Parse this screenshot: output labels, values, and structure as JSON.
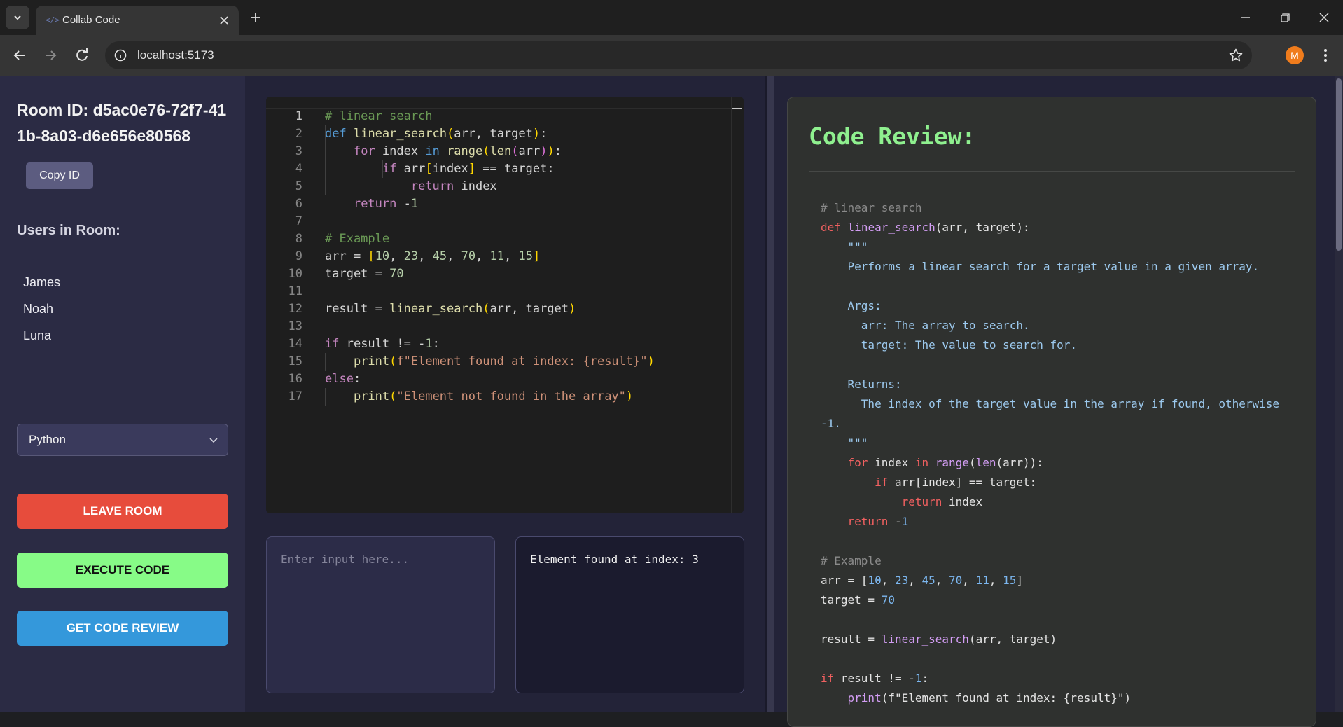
{
  "browser": {
    "tab_title": "Collab Code",
    "url": "localhost:5173",
    "profile_initial": "M"
  },
  "sidebar": {
    "room_id": "Room ID: d5ac0e76-72f7-411b-8a03-d6e656e80568",
    "copy_label": "Copy ID",
    "users_heading": "Users in Room:",
    "users": [
      "James",
      "Noah",
      "Luna"
    ],
    "language": "Python",
    "leave_label": "LEAVE ROOM",
    "execute_label": "EXECUTE CODE",
    "review_label": "GET CODE REVIEW"
  },
  "editor": {
    "current_line": 1,
    "lines": [
      "# linear search",
      "def linear_search(arr, target):",
      "    for index in range(len(arr)):",
      "        if arr[index] == target:",
      "            return index",
      "    return -1",
      "",
      "# Example",
      "arr = [10, 23, 45, 70, 11, 15]",
      "target = 70",
      "",
      "result = linear_search(arr, target)",
      "",
      "if result != -1:",
      "    print(f\"Element found at index: {result}\")",
      "else:",
      "    print(\"Element not found in the array\")"
    ]
  },
  "io": {
    "input_placeholder": "Enter input here...",
    "output": "Element found at index: 3"
  },
  "review": {
    "title": "Code Review:",
    "lines": [
      "# linear search",
      "def linear_search(arr, target):",
      "    \"\"\"",
      "    Performs a linear search for a target value in a given array.",
      "",
      "    Args:",
      "      arr: The array to search.",
      "      target: The value to search for.",
      "",
      "    Returns:",
      "      The index of the target value in the array if found, otherwise",
      "-1.",
      "    \"\"\"",
      "    for index in range(len(arr)):",
      "        if arr[index] == target:",
      "            return index",
      "    return -1",
      "",
      "# Example",
      "arr = [10, 23, 45, 70, 11, 15]",
      "target = 70",
      "",
      "result = linear_search(arr, target)",
      "",
      "if result != -1:",
      "    print(f\"Element found at index: {result}\")"
    ]
  },
  "colors": {
    "leave": "#e74c3c",
    "execute": "#87fb87",
    "review": "#3498db",
    "review_title": "#8ff08f"
  }
}
